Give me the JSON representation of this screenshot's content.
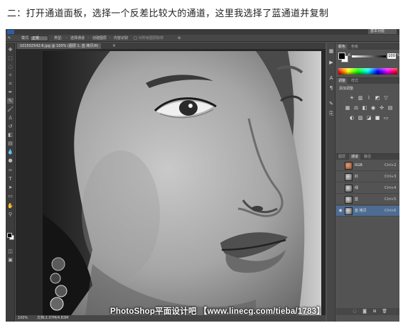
{
  "caption": "二：打开通道面板，选择一个反差比较大的通道，这里我选择了蓝通道并复制",
  "workspace": {
    "label": "基本功能"
  },
  "options_bar": {
    "mode_label": "模式:",
    "mode_value": "正常",
    "type_label": "类型:",
    "select_channel": "选择通道",
    "create_layer": "创建图层",
    "content_aware": "内容识别",
    "sample_all": "对所有图层取样"
  },
  "document": {
    "tab_title": "101502542-6.jpg @ 100% (图层 1, 蓝 拷贝/8)",
    "close_glyph": "×",
    "zoom": "100%",
    "doc_info": "文档:2.07M/4.83M",
    "watermark": "PhotoShop平面设计吧 【www.linecg.com/tieba/1783】"
  },
  "color_panel": {
    "tabs": [
      "颜色",
      "色板"
    ],
    "slider_label": "K",
    "slider_value": "100",
    "slider_unit": "%"
  },
  "adjustments_panel": {
    "tabs": [
      "调整",
      "样式"
    ],
    "hint": "添加调整"
  },
  "channels_panel": {
    "tabs": [
      "图层",
      "通道",
      "路径"
    ],
    "active_tab": 1,
    "channels": [
      {
        "name": "RGB",
        "shortcut": "Ctrl+2",
        "visible": false,
        "selected": false,
        "thumb": "color"
      },
      {
        "name": "红",
        "shortcut": "Ctrl+3",
        "visible": false,
        "selected": false,
        "thumb": "gray"
      },
      {
        "name": "绿",
        "shortcut": "Ctrl+4",
        "visible": false,
        "selected": false,
        "thumb": "gray"
      },
      {
        "name": "蓝",
        "shortcut": "Ctrl+5",
        "visible": false,
        "selected": false,
        "thumb": "gray"
      },
      {
        "name": "蓝 拷贝",
        "shortcut": "Ctrl+6",
        "visible": true,
        "selected": true,
        "thumb": "gray"
      }
    ]
  },
  "colors": {
    "selected_row": "#4d6c94",
    "ps_panel": "#535353"
  },
  "icons": {
    "tools": [
      "move-icon",
      "marquee-icon",
      "lasso-icon",
      "quick-select-icon",
      "crop-icon",
      "eyedropper-icon",
      "healing-icon",
      "brush-icon",
      "clone-stamp-icon",
      "history-brush-icon",
      "eraser-icon",
      "gradient-icon",
      "blur-icon",
      "dodge-icon",
      "pen-icon",
      "type-icon",
      "path-select-icon",
      "shape-icon",
      "hand-icon",
      "zoom-icon"
    ]
  }
}
